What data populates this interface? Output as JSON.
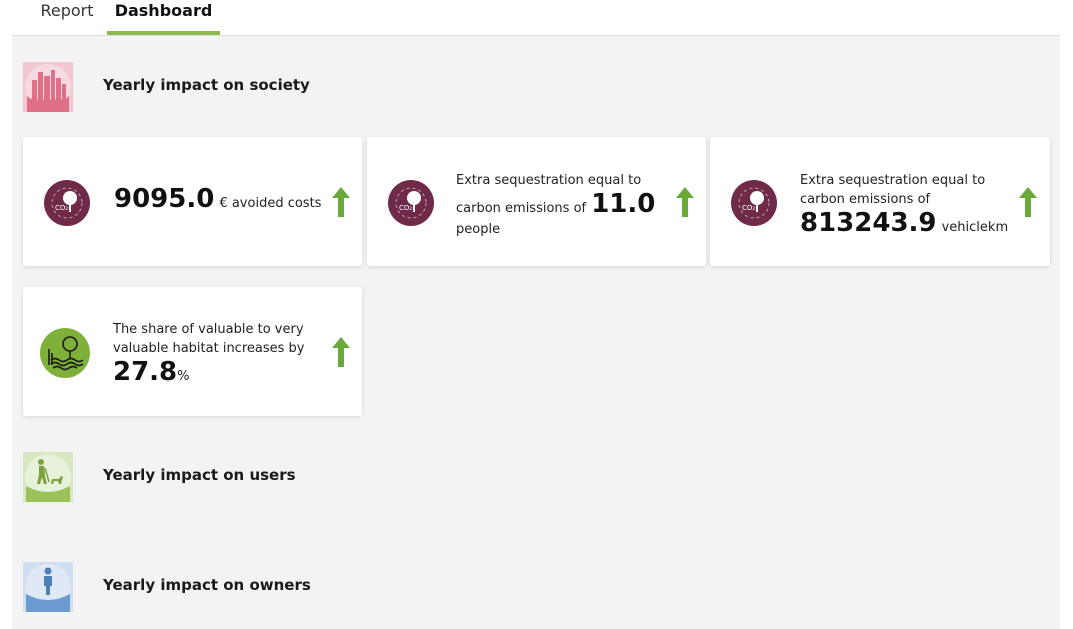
{
  "tabs": [
    {
      "label": "Report",
      "active": false
    },
    {
      "label": "Dashboard",
      "active": true
    }
  ],
  "sections": {
    "society": {
      "title": "Yearly impact on society",
      "icon": "city-skyline-icon",
      "color": "#e07088"
    },
    "users": {
      "title": "Yearly impact on users",
      "icon": "hiker-with-dog-icon",
      "color": "#9ac25a"
    },
    "owners": {
      "title": "Yearly impact on owners",
      "icon": "person-standing-icon",
      "color": "#6c9bd2"
    }
  },
  "cards": [
    {
      "icon": "co2-tree-icon",
      "value": "9095.0",
      "unit": "€ avoided costs",
      "trend": "up"
    },
    {
      "icon": "co2-tree-icon",
      "text_before": "Extra sequestration equal to",
      "text_inline": "carbon emissions of",
      "value": "11.0",
      "unit": "people",
      "trend": "up"
    },
    {
      "icon": "co2-tree-icon",
      "text_before": "Extra sequestration equal to",
      "text_inline": "carbon emissions of",
      "value": "813243.9",
      "unit": "vehiclekm",
      "trend": "up"
    },
    {
      "icon": "habitat-tree-water-icon",
      "text_line1": "The share of valuable to very",
      "text_line2": "valuable habitat increases by",
      "value": "27.8",
      "unit": "%",
      "trend": "up"
    }
  ],
  "colors": {
    "accent": "#8dbb4d",
    "co2_icon": "#6e2a48",
    "arrow": "#6aaa3a",
    "habitat_icon": "#7eb03a"
  }
}
